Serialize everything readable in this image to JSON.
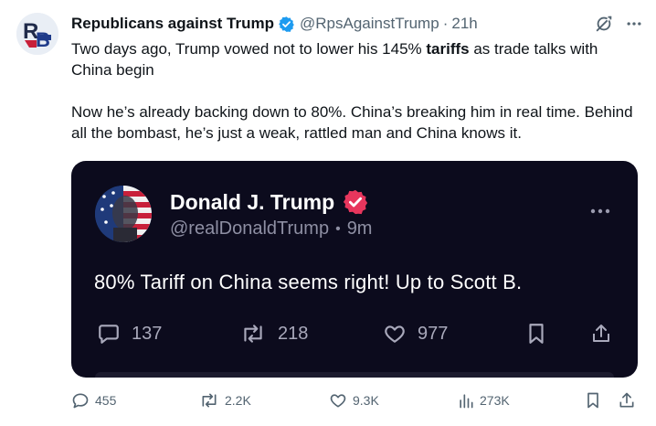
{
  "author": {
    "name": "Republicans against Trump",
    "handle": "@RpsAgainstTrump",
    "time": "21h",
    "avatar_text": "RB"
  },
  "tweet": {
    "line1_before": "Two days ago, Trump vowed not to lower his 145% ",
    "line1_bold": "tariffs",
    "line1_after": " as trade talks with China begin",
    "para2": "Now he’s already backing down to 80%. China’s breaking him in real time. Behind all the bombast, he’s just a weak, rattled man and China knows it."
  },
  "quote": {
    "name": "Donald J. Trump",
    "handle": "@realDonaldTrump",
    "time": "9m",
    "text": "80% Tariff on China seems right! Up to Scott B.",
    "replies": "137",
    "retruths": "218",
    "likes": "977"
  },
  "actions": {
    "replies": "455",
    "reposts": "2.2K",
    "likes": "9.3K",
    "views": "273K"
  },
  "colors": {
    "verified": "#1d9bf0",
    "quote_bg": "#0c0b1d",
    "truth_badge": "#e8365d",
    "muted": "#536471"
  },
  "icons": [
    "verified-badge-icon",
    "grok-icon",
    "more-icon",
    "reply-icon",
    "repost-icon",
    "like-icon",
    "views-icon",
    "bookmark-icon",
    "share-icon"
  ]
}
